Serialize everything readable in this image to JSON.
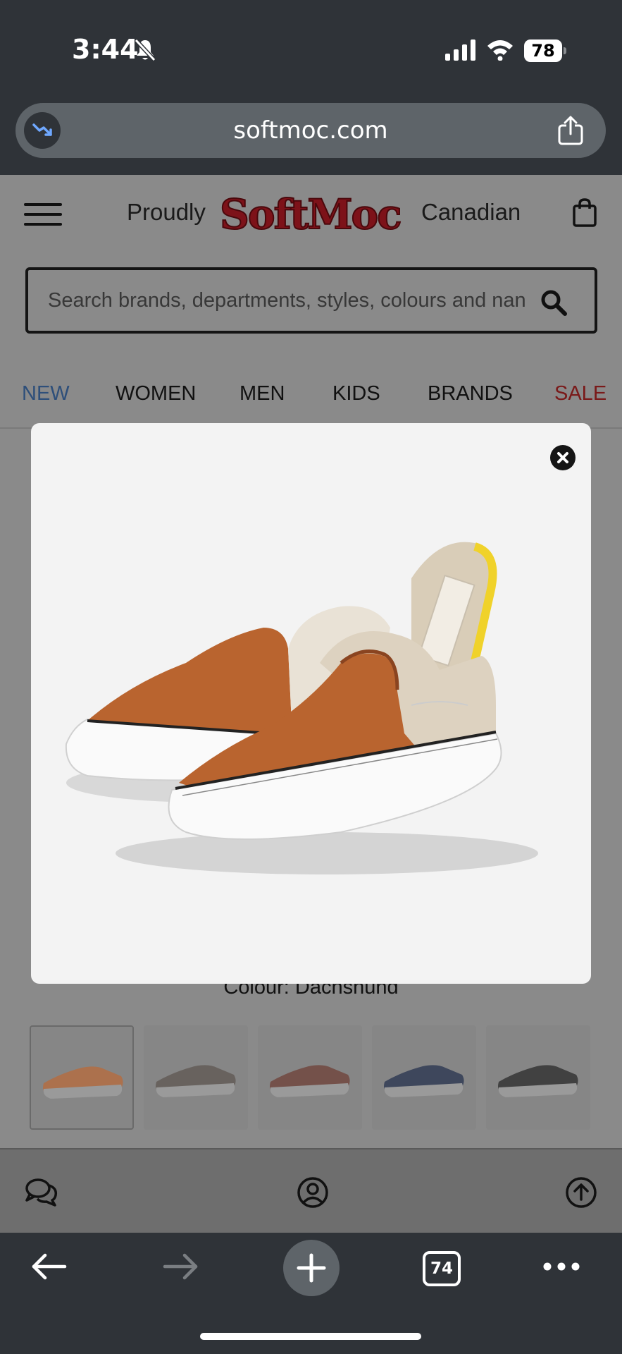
{
  "status_bar": {
    "time": "3:44",
    "battery": "78"
  },
  "browser": {
    "url": "softmoc.com",
    "tab_count": "74"
  },
  "header": {
    "left_text": "Proudly",
    "logo_text": "SoftMoc",
    "right_text": "Canadian"
  },
  "search": {
    "placeholder": "Search brands, departments, styles, colours and nan"
  },
  "nav": {
    "items": [
      "NEW",
      "WOMEN",
      "MEN",
      "KIDS",
      "BRANDS",
      "SALE"
    ]
  },
  "product": {
    "colour_label": "Colour: Dachshund",
    "thumbnail_colors": [
      "#b86a3a",
      "#5e5650",
      "#6e3f36",
      "#26324e",
      "#2a2a2a"
    ]
  },
  "colors": {
    "nav_new": "#2e4f7a",
    "nav_sale": "#7a1a1a",
    "logo": "#7d1219",
    "chrome": "#2f3338"
  }
}
